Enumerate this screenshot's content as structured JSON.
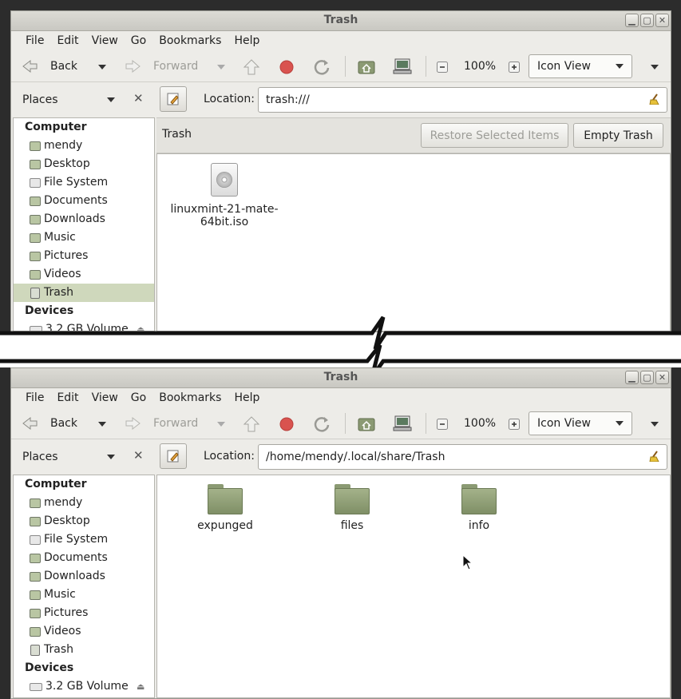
{
  "colors": {
    "accent_green": "#8b9a73",
    "selected_row": "#cfd8bc",
    "stop_red": "#d9534f",
    "background": "#2c2c2c"
  },
  "common": {
    "window_title": "Trash",
    "menu": [
      "File",
      "Edit",
      "View",
      "Go",
      "Bookmarks",
      "Help"
    ],
    "toolbar": {
      "back": "Back",
      "forward": "Forward",
      "zoom": "100%",
      "view": "Icon View"
    },
    "places_label": "Places",
    "location_label": "Location:",
    "sections": {
      "computer": "Computer",
      "devices": "Devices"
    },
    "places": [
      {
        "label": "mendy",
        "icon": "home-folder-icon"
      },
      {
        "label": "Desktop",
        "icon": "desktop-folder-icon"
      },
      {
        "label": "File System",
        "icon": "filesystem-icon"
      },
      {
        "label": "Documents",
        "icon": "documents-folder-icon"
      },
      {
        "label": "Downloads",
        "icon": "downloads-folder-icon"
      },
      {
        "label": "Music",
        "icon": "music-folder-icon"
      },
      {
        "label": "Pictures",
        "icon": "pictures-folder-icon"
      },
      {
        "label": "Videos",
        "icon": "videos-folder-icon"
      },
      {
        "label": "Trash",
        "icon": "trash-icon"
      }
    ],
    "devices": [
      {
        "label": "3.2 GB Volume",
        "icon": "drive-icon"
      }
    ]
  },
  "window1": {
    "location": "trash:///",
    "info_title": "Trash",
    "restore_button": "Restore Selected Items",
    "empty_button": "Empty Trash",
    "files": [
      {
        "name_line1": "linuxmint-21-mate-",
        "name_line2": "64bit.iso",
        "icon": "disc-image-icon"
      }
    ]
  },
  "window2": {
    "location": "/home/mendy/.local/share/Trash",
    "folders": [
      {
        "name": "expunged",
        "icon": "folder-icon"
      },
      {
        "name": "files",
        "icon": "folder-icon"
      },
      {
        "name": "info",
        "icon": "folder-icon"
      }
    ]
  }
}
